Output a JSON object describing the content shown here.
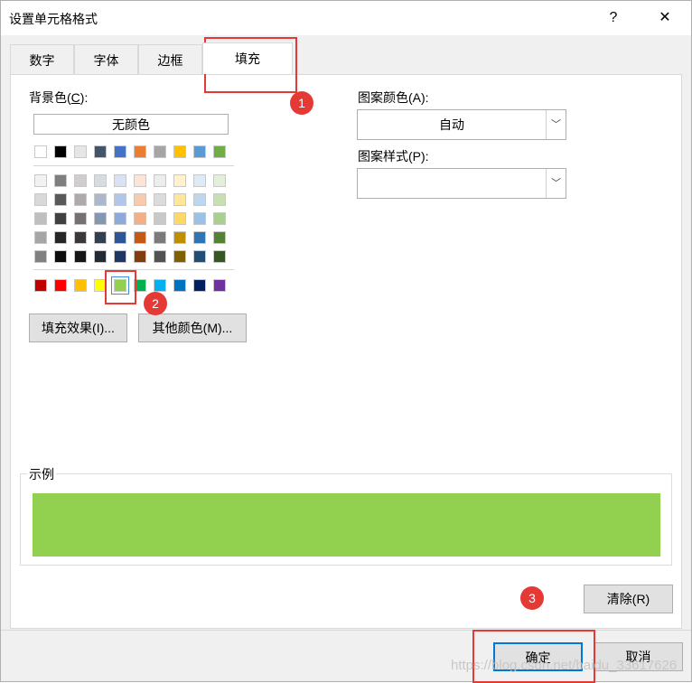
{
  "window": {
    "title": "设置单元格格式",
    "help": "?",
    "close": "✕"
  },
  "tabs": [
    "数字",
    "字体",
    "边框",
    "填充"
  ],
  "active_tab": "填充",
  "background": {
    "label_prefix": "背景色(",
    "label_key": "C",
    "label_suffix": "):",
    "no_color": "无颜色",
    "theme_top": [
      "#ffffff",
      "#000000",
      "#e7e6e6",
      "#44546a",
      "#4472c4",
      "#ed7d31",
      "#a5a5a5",
      "#ffc000",
      "#5b9bd5",
      "#70ad47"
    ],
    "theme_rows": [
      [
        "#f2f2f2",
        "#7f7f7f",
        "#d0cece",
        "#d6dce4",
        "#d9e1f2",
        "#fce4d6",
        "#ededed",
        "#fff2cc",
        "#ddebf7",
        "#e2efda"
      ],
      [
        "#d9d9d9",
        "#595959",
        "#aeaaaa",
        "#acb9ca",
        "#b4c6e7",
        "#f8cbad",
        "#dbdbdb",
        "#ffe699",
        "#bdd7ee",
        "#c6e0b4"
      ],
      [
        "#bfbfbf",
        "#404040",
        "#757171",
        "#8497b0",
        "#8ea9db",
        "#f4b084",
        "#c9c9c9",
        "#ffd966",
        "#9bc2e6",
        "#a9d08e"
      ],
      [
        "#a6a6a6",
        "#262626",
        "#3a3838",
        "#333f4f",
        "#2f5597",
        "#c65911",
        "#7b7b7b",
        "#bf8f00",
        "#2e75b6",
        "#548235"
      ],
      [
        "#808080",
        "#0d0d0d",
        "#161616",
        "#222b35",
        "#203764",
        "#833c0c",
        "#525252",
        "#806000",
        "#1f4e78",
        "#375623"
      ]
    ],
    "standard": [
      "#c00000",
      "#ff0000",
      "#ffc000",
      "#ffff00",
      "#92d050",
      "#00b050",
      "#00b0f0",
      "#0070c0",
      "#002060",
      "#7030a0"
    ],
    "selected_color": "#92d050"
  },
  "buttons": {
    "fill_effects": "填充效果(I)...",
    "more_colors": "其他颜色(M)...",
    "clear": "清除(R)",
    "ok": "确定",
    "cancel": "取消"
  },
  "pattern": {
    "color_label": "图案颜色(A):",
    "color_value": "自动",
    "style_label": "图案样式(P):",
    "style_value": ""
  },
  "sample": {
    "label": "示例",
    "color": "#92d050"
  },
  "annotations": [
    "1",
    "2",
    "3"
  ],
  "accent_color": "#e53935",
  "watermark": "https://blog.csdn.net/baidu_33617626"
}
